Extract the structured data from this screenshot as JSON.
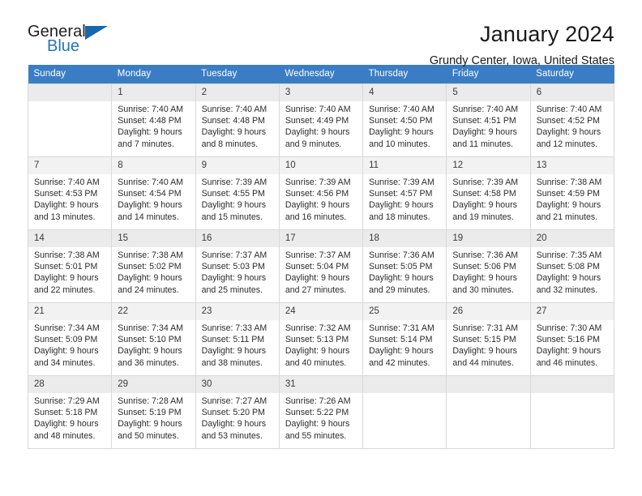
{
  "brand": {
    "name_part1": "General",
    "name_part2": "Blue",
    "triangle_color": "#1668ac",
    "blue_color": "#1f76bc"
  },
  "header": {
    "title": "January 2024",
    "location": "Grundy Center, Iowa, United States"
  },
  "calendar": {
    "header_bg": "#3b7dc4",
    "weekdays": [
      "Sunday",
      "Monday",
      "Tuesday",
      "Wednesday",
      "Thursday",
      "Friday",
      "Saturday"
    ],
    "weeks": [
      [
        {
          "day": ""
        },
        {
          "day": "1",
          "sunrise": "Sunrise: 7:40 AM",
          "sunset": "Sunset: 4:48 PM",
          "daylight1": "Daylight: 9 hours",
          "daylight2": "and 7 minutes."
        },
        {
          "day": "2",
          "sunrise": "Sunrise: 7:40 AM",
          "sunset": "Sunset: 4:48 PM",
          "daylight1": "Daylight: 9 hours",
          "daylight2": "and 8 minutes."
        },
        {
          "day": "3",
          "sunrise": "Sunrise: 7:40 AM",
          "sunset": "Sunset: 4:49 PM",
          "daylight1": "Daylight: 9 hours",
          "daylight2": "and 9 minutes."
        },
        {
          "day": "4",
          "sunrise": "Sunrise: 7:40 AM",
          "sunset": "Sunset: 4:50 PM",
          "daylight1": "Daylight: 9 hours",
          "daylight2": "and 10 minutes."
        },
        {
          "day": "5",
          "sunrise": "Sunrise: 7:40 AM",
          "sunset": "Sunset: 4:51 PM",
          "daylight1": "Daylight: 9 hours",
          "daylight2": "and 11 minutes."
        },
        {
          "day": "6",
          "sunrise": "Sunrise: 7:40 AM",
          "sunset": "Sunset: 4:52 PM",
          "daylight1": "Daylight: 9 hours",
          "daylight2": "and 12 minutes."
        }
      ],
      [
        {
          "day": "7",
          "sunrise": "Sunrise: 7:40 AM",
          "sunset": "Sunset: 4:53 PM",
          "daylight1": "Daylight: 9 hours",
          "daylight2": "and 13 minutes."
        },
        {
          "day": "8",
          "sunrise": "Sunrise: 7:40 AM",
          "sunset": "Sunset: 4:54 PM",
          "daylight1": "Daylight: 9 hours",
          "daylight2": "and 14 minutes."
        },
        {
          "day": "9",
          "sunrise": "Sunrise: 7:39 AM",
          "sunset": "Sunset: 4:55 PM",
          "daylight1": "Daylight: 9 hours",
          "daylight2": "and 15 minutes."
        },
        {
          "day": "10",
          "sunrise": "Sunrise: 7:39 AM",
          "sunset": "Sunset: 4:56 PM",
          "daylight1": "Daylight: 9 hours",
          "daylight2": "and 16 minutes."
        },
        {
          "day": "11",
          "sunrise": "Sunrise: 7:39 AM",
          "sunset": "Sunset: 4:57 PM",
          "daylight1": "Daylight: 9 hours",
          "daylight2": "and 18 minutes."
        },
        {
          "day": "12",
          "sunrise": "Sunrise: 7:39 AM",
          "sunset": "Sunset: 4:58 PM",
          "daylight1": "Daylight: 9 hours",
          "daylight2": "and 19 minutes."
        },
        {
          "day": "13",
          "sunrise": "Sunrise: 7:38 AM",
          "sunset": "Sunset: 4:59 PM",
          "daylight1": "Daylight: 9 hours",
          "daylight2": "and 21 minutes."
        }
      ],
      [
        {
          "day": "14",
          "sunrise": "Sunrise: 7:38 AM",
          "sunset": "Sunset: 5:01 PM",
          "daylight1": "Daylight: 9 hours",
          "daylight2": "and 22 minutes."
        },
        {
          "day": "15",
          "sunrise": "Sunrise: 7:38 AM",
          "sunset": "Sunset: 5:02 PM",
          "daylight1": "Daylight: 9 hours",
          "daylight2": "and 24 minutes."
        },
        {
          "day": "16",
          "sunrise": "Sunrise: 7:37 AM",
          "sunset": "Sunset: 5:03 PM",
          "daylight1": "Daylight: 9 hours",
          "daylight2": "and 25 minutes."
        },
        {
          "day": "17",
          "sunrise": "Sunrise: 7:37 AM",
          "sunset": "Sunset: 5:04 PM",
          "daylight1": "Daylight: 9 hours",
          "daylight2": "and 27 minutes."
        },
        {
          "day": "18",
          "sunrise": "Sunrise: 7:36 AM",
          "sunset": "Sunset: 5:05 PM",
          "daylight1": "Daylight: 9 hours",
          "daylight2": "and 29 minutes."
        },
        {
          "day": "19",
          "sunrise": "Sunrise: 7:36 AM",
          "sunset": "Sunset: 5:06 PM",
          "daylight1": "Daylight: 9 hours",
          "daylight2": "and 30 minutes."
        },
        {
          "day": "20",
          "sunrise": "Sunrise: 7:35 AM",
          "sunset": "Sunset: 5:08 PM",
          "daylight1": "Daylight: 9 hours",
          "daylight2": "and 32 minutes."
        }
      ],
      [
        {
          "day": "21",
          "sunrise": "Sunrise: 7:34 AM",
          "sunset": "Sunset: 5:09 PM",
          "daylight1": "Daylight: 9 hours",
          "daylight2": "and 34 minutes."
        },
        {
          "day": "22",
          "sunrise": "Sunrise: 7:34 AM",
          "sunset": "Sunset: 5:10 PM",
          "daylight1": "Daylight: 9 hours",
          "daylight2": "and 36 minutes."
        },
        {
          "day": "23",
          "sunrise": "Sunrise: 7:33 AM",
          "sunset": "Sunset: 5:11 PM",
          "daylight1": "Daylight: 9 hours",
          "daylight2": "and 38 minutes."
        },
        {
          "day": "24",
          "sunrise": "Sunrise: 7:32 AM",
          "sunset": "Sunset: 5:13 PM",
          "daylight1": "Daylight: 9 hours",
          "daylight2": "and 40 minutes."
        },
        {
          "day": "25",
          "sunrise": "Sunrise: 7:31 AM",
          "sunset": "Sunset: 5:14 PM",
          "daylight1": "Daylight: 9 hours",
          "daylight2": "and 42 minutes."
        },
        {
          "day": "26",
          "sunrise": "Sunrise: 7:31 AM",
          "sunset": "Sunset: 5:15 PM",
          "daylight1": "Daylight: 9 hours",
          "daylight2": "and 44 minutes."
        },
        {
          "day": "27",
          "sunrise": "Sunrise: 7:30 AM",
          "sunset": "Sunset: 5:16 PM",
          "daylight1": "Daylight: 9 hours",
          "daylight2": "and 46 minutes."
        }
      ],
      [
        {
          "day": "28",
          "sunrise": "Sunrise: 7:29 AM",
          "sunset": "Sunset: 5:18 PM",
          "daylight1": "Daylight: 9 hours",
          "daylight2": "and 48 minutes."
        },
        {
          "day": "29",
          "sunrise": "Sunrise: 7:28 AM",
          "sunset": "Sunset: 5:19 PM",
          "daylight1": "Daylight: 9 hours",
          "daylight2": "and 50 minutes."
        },
        {
          "day": "30",
          "sunrise": "Sunrise: 7:27 AM",
          "sunset": "Sunset: 5:20 PM",
          "daylight1": "Daylight: 9 hours",
          "daylight2": "and 53 minutes."
        },
        {
          "day": "31",
          "sunrise": "Sunrise: 7:26 AM",
          "sunset": "Sunset: 5:22 PM",
          "daylight1": "Daylight: 9 hours",
          "daylight2": "and 55 minutes."
        },
        {
          "day": ""
        },
        {
          "day": ""
        },
        {
          "day": ""
        }
      ]
    ]
  }
}
